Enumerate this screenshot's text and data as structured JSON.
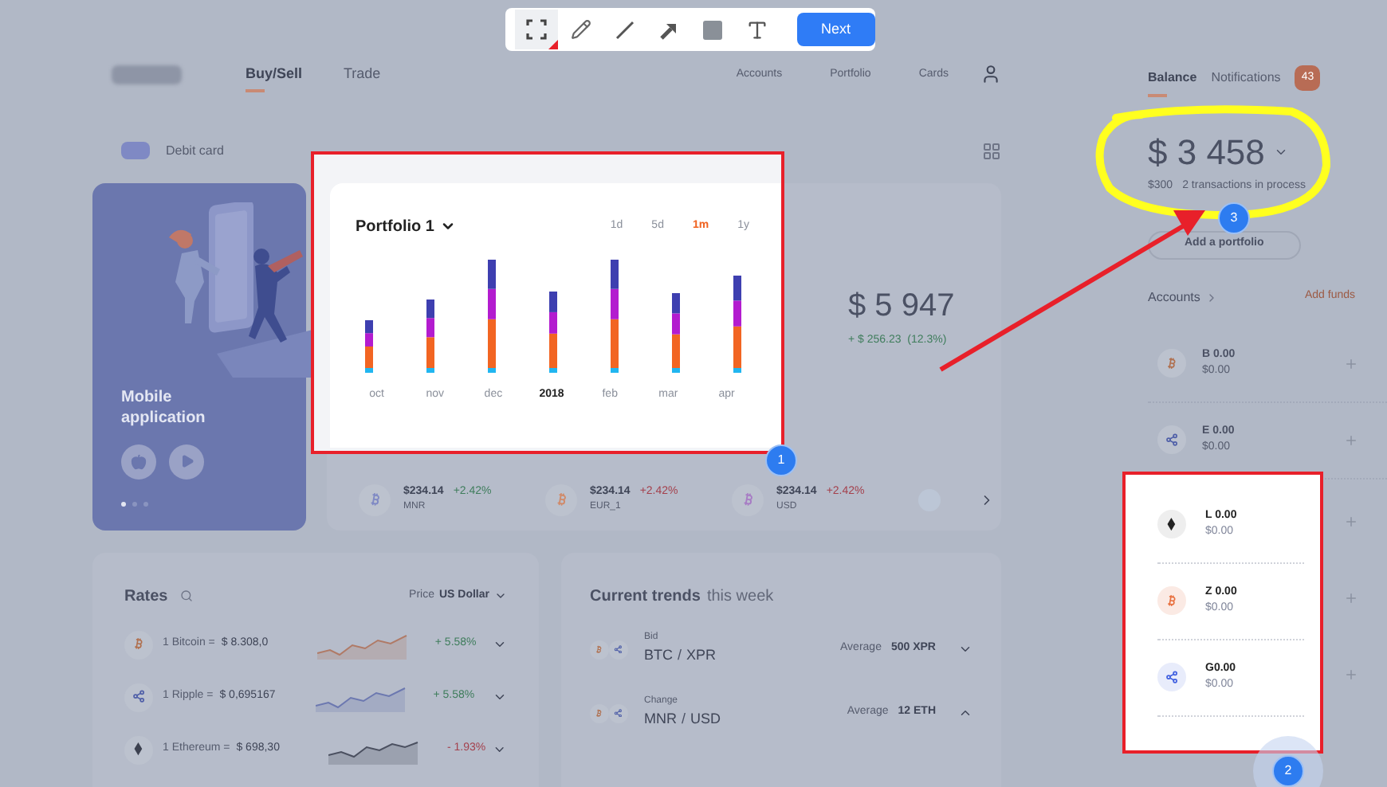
{
  "toolbar": {
    "tools": [
      {
        "kind": "select",
        "selected": true
      },
      {
        "kind": "pencil",
        "selected": false
      },
      {
        "kind": "line",
        "selected": false
      },
      {
        "kind": "arrow",
        "selected": false
      },
      {
        "kind": "rectangle",
        "selected": false
      },
      {
        "kind": "text",
        "selected": false
      }
    ],
    "next_button": "Next"
  },
  "header": {
    "tabs": [
      {
        "label": "Buy/Sell",
        "selected": true
      },
      {
        "label": "Trade",
        "selected": false
      }
    ],
    "nav": [
      "Accounts",
      "Portfolio",
      "Cards"
    ]
  },
  "debit_card": {
    "label": "Debit card"
  },
  "promo": {
    "title": "Mobile application",
    "pages": [
      {
        "selected": true
      },
      {
        "selected": false
      },
      {
        "selected": false
      }
    ]
  },
  "portfolio_chart": {
    "title": "Portfolio 1",
    "ranges": [
      {
        "label": "1d",
        "selected": false
      },
      {
        "label": "5d",
        "selected": false
      },
      {
        "label": "1m",
        "selected": true
      },
      {
        "label": "1y",
        "selected": false
      }
    ],
    "months": [
      {
        "label": "oct",
        "bold": false
      },
      {
        "label": "nov",
        "bold": false
      },
      {
        "label": "dec",
        "bold": false
      },
      {
        "label": "2018",
        "bold": true
      },
      {
        "label": "feb",
        "bold": false
      },
      {
        "label": "mar",
        "bold": false
      },
      {
        "label": "apr",
        "bold": false
      }
    ]
  },
  "portfolio_value": {
    "amount": "$ 5 947",
    "change": "+ $ 256.23  (12.3%)"
  },
  "tickers": [
    {
      "price": "$234.14",
      "change": {
        "text": "+2.42%",
        "kind": "gain"
      },
      "code": "MNR",
      "icon": {
        "kind": "bitcoin"
      },
      "color": "#7f89c4"
    },
    {
      "price": "$234.14",
      "change": {
        "text": "+2.42%",
        "kind": "loss"
      },
      "code": "EUR_1",
      "icon": {
        "kind": "bitcoin"
      },
      "color": "#d08a6a"
    },
    {
      "price": "$234.14",
      "change": {
        "text": "+2.42%",
        "kind": "loss"
      },
      "code": "USD",
      "icon": {
        "kind": "bitcoin"
      },
      "color": "#a77cc4"
    }
  ],
  "rates": {
    "title": "Rates",
    "price_label": "Price",
    "currency": "US Dollar",
    "rows": [
      {
        "name": "1 Bitcoin =",
        "value": "$ 8.308,0",
        "change": {
          "text": "+ 5.58%",
          "kind": "gain"
        },
        "icon": {
          "kind": "bitcoin"
        }
      },
      {
        "name": "1 Ripple =",
        "value": "$ 0,695167",
        "change": {
          "text": "+ 5.58%",
          "kind": "gain"
        },
        "icon": {
          "kind": "ripple"
        }
      },
      {
        "name": "1 Ethereum =",
        "value": "$ 698,30",
        "change": {
          "text": "- 1.93%",
          "kind": "loss"
        },
        "icon": {
          "kind": "ethereum"
        }
      }
    ]
  },
  "trends": {
    "title": "Current trends",
    "period": "this week",
    "rows": [
      {
        "label": "Bid",
        "base": "BTC",
        "separator": "/",
        "quote": "XPR",
        "average_label": "Average",
        "average": "500 XPR",
        "expanded": false
      },
      {
        "label": "Change",
        "base": "MNR",
        "separator": "/",
        "quote": "USD",
        "average_label": "Average",
        "average": "12 ETH",
        "expanded": true
      }
    ]
  },
  "balance_panel": {
    "tabs": [
      {
        "label": "Balance",
        "selected": true
      },
      {
        "label": "Notifications",
        "selected": false
      }
    ],
    "notification_count": "43",
    "balance": "$ 3 458",
    "pending_amount": "$300",
    "pending": "2 transactions in process",
    "add_portfolio": "Add a portfolio",
    "accounts_title": "Accounts",
    "add_funds": "Add funds",
    "accounts": [
      {
        "label": "B 0.00",
        "value": "$0.00",
        "icon": {
          "kind": "bitcoin"
        },
        "highlighted": false
      },
      {
        "label": "E 0.00",
        "value": "$0.00",
        "icon": {
          "kind": "ripple"
        },
        "highlighted": false
      },
      {
        "label": "L 0.00",
        "value": "$0.00",
        "icon": {
          "kind": "ethereum"
        },
        "highlighted": true
      },
      {
        "label": "Z 0.00",
        "value": "$0.00",
        "icon": {
          "kind": "bitcoin"
        },
        "highlighted": true
      },
      {
        "label": "G0.00",
        "value": "$0.00",
        "icon": {
          "kind": "ripple"
        },
        "highlighted": true
      }
    ]
  },
  "annotations": [
    {
      "number": "1"
    },
    {
      "number": "2"
    },
    {
      "number": "3"
    }
  ]
}
